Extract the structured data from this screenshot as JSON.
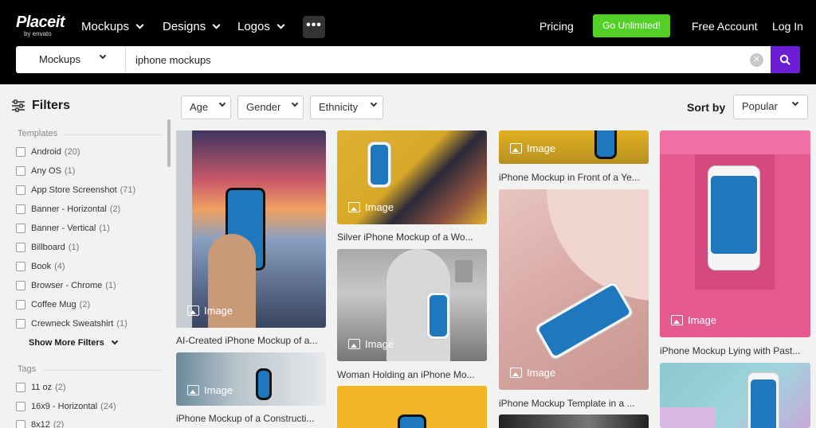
{
  "header": {
    "logo_main": "Placeit",
    "logo_sub": "by envato",
    "nav": [
      "Mockups",
      "Designs",
      "Logos"
    ],
    "more_label": "•••",
    "pricing": "Pricing",
    "go_unlimited": "Go Unlimited!",
    "free_account": "Free Account",
    "log_in": "Log In"
  },
  "search": {
    "category": "Mockups",
    "query": "iphone mockups",
    "clear_label": "✕"
  },
  "sidebar": {
    "title": "Filters",
    "templates_label": "Templates",
    "templates": [
      {
        "label": "Android",
        "count": "(20)"
      },
      {
        "label": "Any OS",
        "count": "(1)"
      },
      {
        "label": "App Store Screenshot",
        "count": "(71)"
      },
      {
        "label": "Banner - Horizontal",
        "count": "(2)"
      },
      {
        "label": "Banner - Vertical",
        "count": "(1)"
      },
      {
        "label": "Billboard",
        "count": "(1)"
      },
      {
        "label": "Book",
        "count": "(4)"
      },
      {
        "label": "Browser - Chrome",
        "count": "(1)"
      },
      {
        "label": "Coffee Mug",
        "count": "(2)"
      },
      {
        "label": "Crewneck Sweatshirt",
        "count": "(1)"
      }
    ],
    "show_more": "Show More Filters",
    "tags_label": "Tags",
    "tags": [
      {
        "label": "11 oz",
        "count": "(2)"
      },
      {
        "label": "16x9 - Horizontal",
        "count": "(24)"
      },
      {
        "label": "8x12",
        "count": "(2)"
      }
    ]
  },
  "filters": {
    "age": "Age",
    "gender": "Gender",
    "ethnicity": "Ethnicity",
    "sort_label": "Sort by",
    "sort_value": "Popular"
  },
  "results": {
    "badge_label": "Image",
    "captions": [
      "AI-Created iPhone Mockup of a...",
      "iPhone Mockup of a Constructi...",
      "Silver iPhone Mockup of a Wo...",
      "Woman Holding an iPhone Mo...",
      "iPhone Mockup in Front of a Ye...",
      "iPhone Mockup Template in a ...",
      "iPhone Mockup Lying with Past..."
    ]
  },
  "colors": {
    "header_bg": "#000000",
    "go_btn": "#53cf28",
    "search_btn": "#6b1ed6"
  }
}
